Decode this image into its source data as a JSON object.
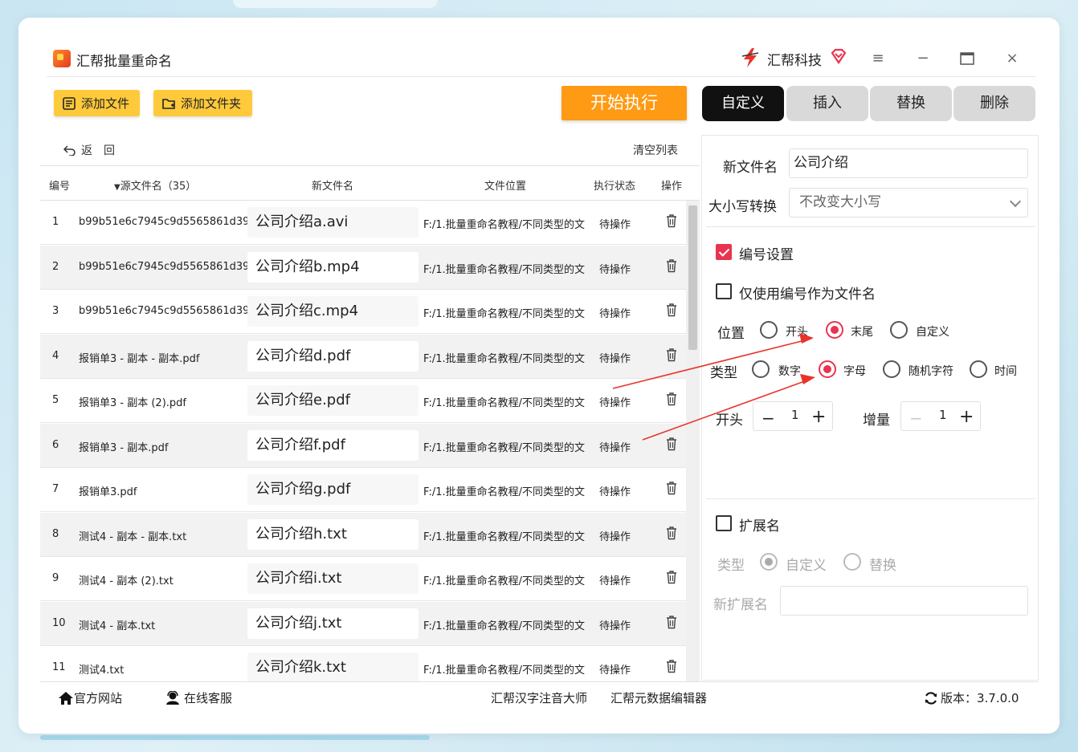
{
  "app": {
    "title": "汇帮批量重命名",
    "brand": "汇帮科技"
  },
  "toolbar": {
    "add_file": "添加文件",
    "add_folder": "添加文件夹",
    "start": "开始执行"
  },
  "tabs": [
    {
      "label": "自定义",
      "active": true
    },
    {
      "label": "插入",
      "active": false
    },
    {
      "label": "替换",
      "active": false
    },
    {
      "label": "删除",
      "active": false
    }
  ],
  "nav": {
    "back": "返　回",
    "clear": "清空列表"
  },
  "table": {
    "headers": {
      "no": "编号",
      "src": "源文件名（35）",
      "new": "新文件名",
      "path": "文件位置",
      "status": "执行状态",
      "op": "操作"
    },
    "rows": [
      {
        "no": "1",
        "src": "b99b51e6c7945c9d5565861d39",
        "new": "公司介绍a.avi",
        "path": "F:/1.批量重命名教程/不同类型的文",
        "status": "待操作"
      },
      {
        "no": "2",
        "src": "b99b51e6c7945c9d5565861d39",
        "new": "公司介绍b.mp4",
        "path": "F:/1.批量重命名教程/不同类型的文",
        "status": "待操作"
      },
      {
        "no": "3",
        "src": "b99b51e6c7945c9d5565861d39",
        "new": "公司介绍c.mp4",
        "path": "F:/1.批量重命名教程/不同类型的文",
        "status": "待操作"
      },
      {
        "no": "4",
        "src": "报销单3 - 副本 - 副本.pdf",
        "new": "公司介绍d.pdf",
        "path": "F:/1.批量重命名教程/不同类型的文",
        "status": "待操作"
      },
      {
        "no": "5",
        "src": "报销单3 - 副本 (2).pdf",
        "new": "公司介绍e.pdf",
        "path": "F:/1.批量重命名教程/不同类型的文",
        "status": "待操作"
      },
      {
        "no": "6",
        "src": "报销单3 - 副本.pdf",
        "new": "公司介绍f.pdf",
        "path": "F:/1.批量重命名教程/不同类型的文",
        "status": "待操作"
      },
      {
        "no": "7",
        "src": "报销单3.pdf",
        "new": "公司介绍g.pdf",
        "path": "F:/1.批量重命名教程/不同类型的文",
        "status": "待操作"
      },
      {
        "no": "8",
        "src": "测试4 - 副本 - 副本.txt",
        "new": "公司介绍h.txt",
        "path": "F:/1.批量重命名教程/不同类型的文",
        "status": "待操作"
      },
      {
        "no": "9",
        "src": "测试4 - 副本 (2).txt",
        "new": "公司介绍i.txt",
        "path": "F:/1.批量重命名教程/不同类型的文",
        "status": "待操作"
      },
      {
        "no": "10",
        "src": "测试4 - 副本.txt",
        "new": "公司介绍j.txt",
        "path": "F:/1.批量重命名教程/不同类型的文",
        "status": "待操作"
      },
      {
        "no": "11",
        "src": "测试4.txt",
        "new": "公司介绍k.txt",
        "path": "F:/1.批量重命名教程/不同类型的文",
        "status": "待操作"
      }
    ]
  },
  "panel": {
    "new_name_label": "新文件名",
    "new_name_value": "公司介绍",
    "case_label": "大小写转换",
    "case_value": "不改变大小写",
    "numbering": {
      "label": "编号设置",
      "checked": true
    },
    "only_number": {
      "label": "仅使用编号作为文件名",
      "checked": false
    },
    "position": {
      "label": "位置",
      "options": [
        "开头",
        "末尾",
        "自定义"
      ],
      "selected": "末尾"
    },
    "type": {
      "label": "类型",
      "options": [
        "数字",
        "字母",
        "随机字符",
        "时间"
      ],
      "selected": "字母"
    },
    "start": {
      "label": "开头",
      "minus": "−",
      "value": "1",
      "plus": "+"
    },
    "increment": {
      "label": "增量",
      "minus": "−",
      "value": "1",
      "plus": "+"
    },
    "extension": {
      "label": "扩展名",
      "checked": false
    },
    "ext_type": {
      "label": "类型",
      "options": [
        "自定义",
        "替换"
      ],
      "selected": "自定义"
    },
    "new_ext_label": "新扩展名",
    "new_ext_value": ""
  },
  "footer": {
    "website": "官方网站",
    "support": "在线客服",
    "link1": "汇帮汉字注音大师",
    "link2": "汇帮元数据编辑器",
    "version": "版本：3.7.0.0"
  },
  "colors": {
    "accent": "#e8344e",
    "yellow": "#ffc93c",
    "orange": "#ff9a14",
    "arrow": "#e8342a"
  }
}
